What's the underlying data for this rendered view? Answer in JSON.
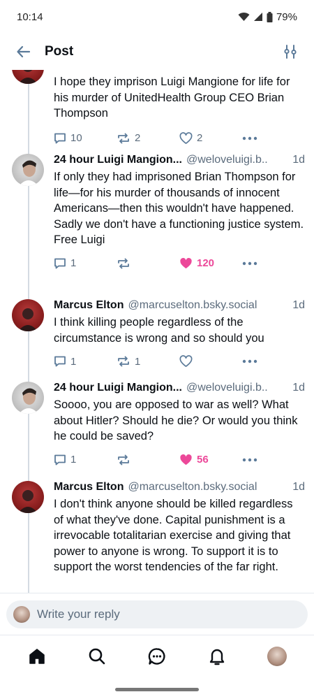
{
  "status": {
    "time": "10:14",
    "battery": "79%"
  },
  "header": {
    "title": "Post"
  },
  "posts": [
    {
      "author": "",
      "handle": "",
      "time": "",
      "text": "I hope they imprison Luigi Mangione for life for his murder of UnitedHealth Group CEO Brian Thompson",
      "replies": "10",
      "reposts": "2",
      "likes": "2",
      "liked": false
    },
    {
      "author": "24 hour Luigi Mangion...",
      "handle": "@weloveluigi.b..",
      "time": "1d",
      "text": "If only they had imprisoned Brian Thompson for life—for his murder of thousands of innocent Americans—then this wouldn't have happened. Sadly we don't have a functioning justice system. Free Luigi",
      "replies": "1",
      "reposts": "",
      "likes": "120",
      "liked": true
    },
    {
      "author": "Marcus Elton",
      "handle": "@marcuselton.bsky.social",
      "time": "1d",
      "text": "I think killing people regardless of the circumstance is wrong and so should you",
      "replies": "1",
      "reposts": "1",
      "likes": "",
      "liked": false
    },
    {
      "author": "24 hour Luigi Mangion...",
      "handle": "@weloveluigi.b..",
      "time": "1d",
      "text": "Soooo, you are opposed to war as well? What about Hitler? Should he die? Or would you think he could be saved?",
      "replies": "1",
      "reposts": "",
      "likes": "56",
      "liked": true
    },
    {
      "author": "Marcus Elton",
      "handle": "@marcuselton.bsky.social",
      "time": "1d",
      "text": "I don't think anyone should be killed regardless of what they've done. Capital punishment is a irrevocable totalitarian exercise and giving that power to anyone is wrong. To support it is to support the worst tendencies of the far right."
    }
  ],
  "reply_bar": {
    "placeholder": "Write your reply"
  },
  "icons": {
    "back": "arrow-left-icon",
    "filter": "sliders-icon",
    "reply": "speech-bubble-icon",
    "repost": "repost-icon",
    "like": "heart-icon",
    "more": "ellipsis-icon",
    "home": "home-icon",
    "search": "search-icon",
    "chat": "chat-icon",
    "notifications": "bell-icon"
  },
  "colors": {
    "accent": "#1083fe",
    "like": "#ec4899",
    "muted": "#5b6b7c",
    "icon": "#5b7a99"
  }
}
